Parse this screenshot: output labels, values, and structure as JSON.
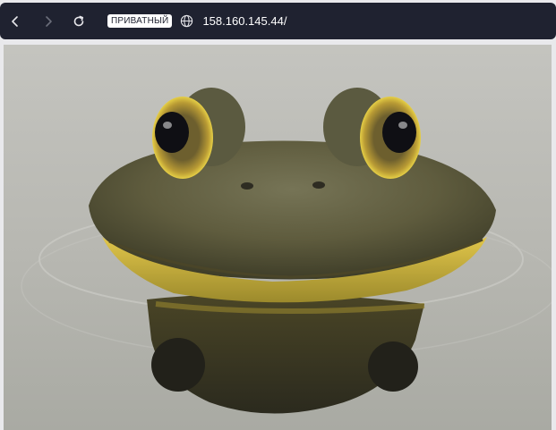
{
  "toolbar": {
    "private_badge": "ПРИВАТНЫЙ",
    "url": "158.160.145.44/",
    "icons": [
      "back-icon",
      "forward-icon",
      "reload-icon",
      "globe-icon"
    ]
  },
  "page": {
    "image_alt": "",
    "colors": {
      "toolbar_bg": "#1f2230",
      "badge_bg": "#ffffff",
      "water": "#b9b9b4",
      "frog_skin": "#5d5a3c",
      "frog_lip": "#cdb23a",
      "eye_iris": "#c6a934",
      "eye_pupil": "#0f0f14"
    }
  }
}
